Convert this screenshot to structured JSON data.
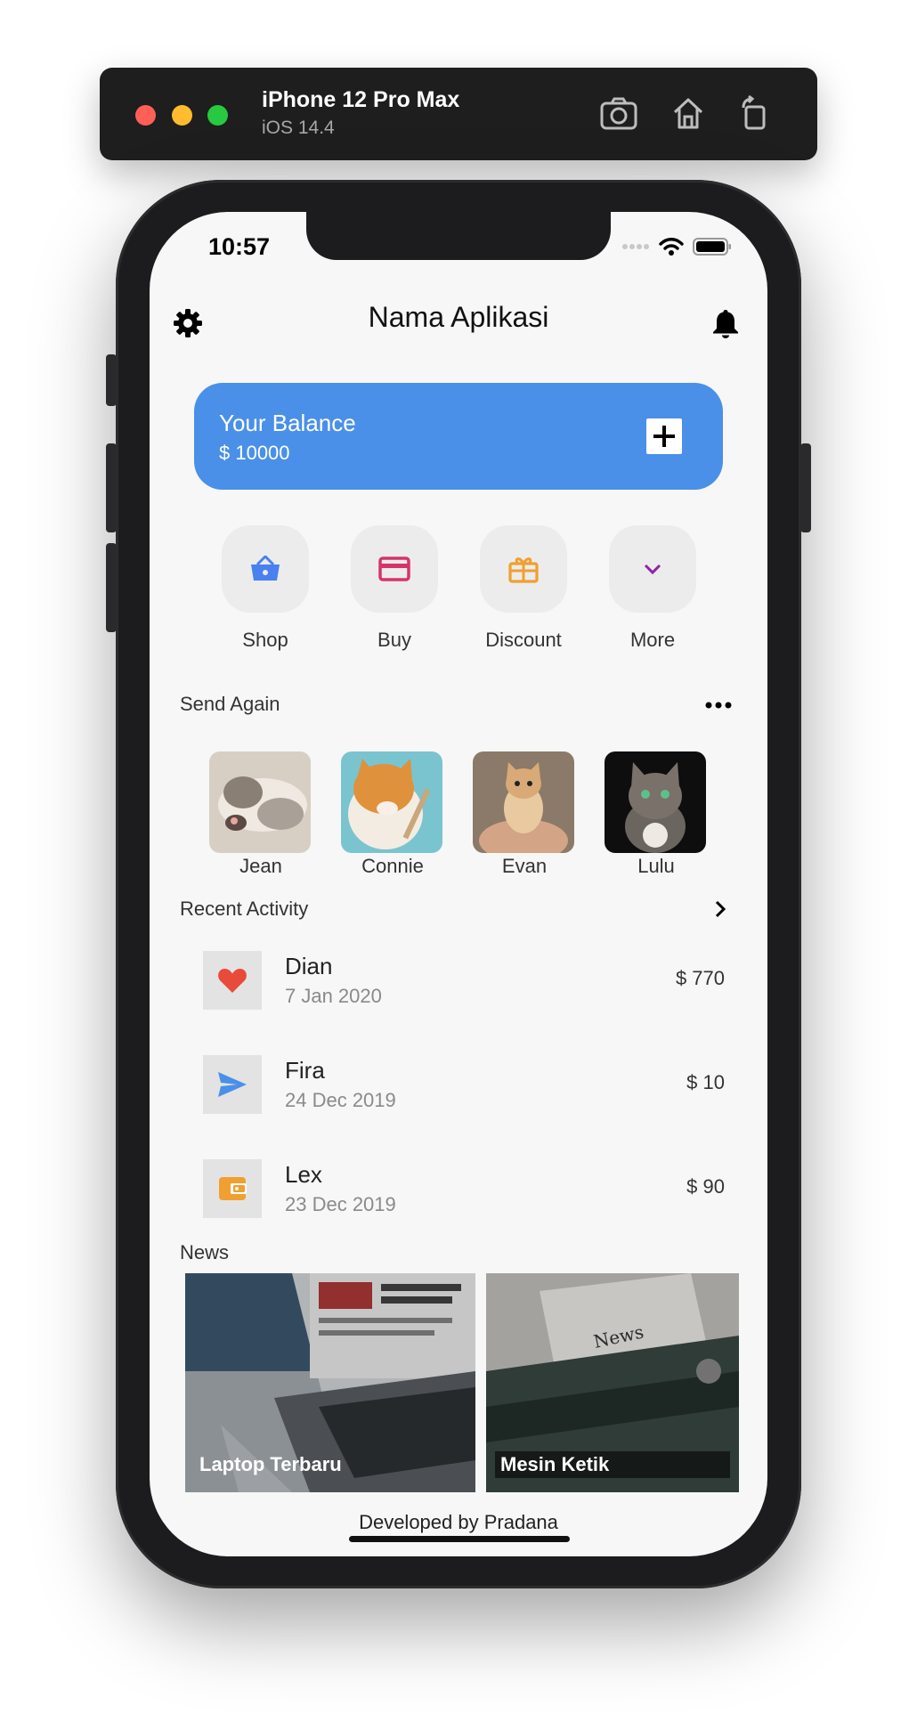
{
  "simulator": {
    "device_name": "iPhone 12 Pro Max",
    "os_version": "iOS 14.4",
    "buttons": [
      "screenshot-icon",
      "home-icon",
      "rotate-icon"
    ]
  },
  "status_bar": {
    "time": "10:57"
  },
  "app": {
    "title": "Nama Aplikasi",
    "settings_icon": "gear-icon",
    "notification_icon": "bell-icon"
  },
  "balance": {
    "label": "Your Balance",
    "amount": "$ 10000",
    "add_icon": "plus-icon",
    "color": "#4a90e8"
  },
  "actions": [
    {
      "label": "Shop",
      "icon": "basket-icon",
      "color": "#4a80f0"
    },
    {
      "label": "Buy",
      "icon": "credit-card-icon",
      "color": "#d6336c"
    },
    {
      "label": "Discount",
      "icon": "gift-icon",
      "color": "#f0a030"
    },
    {
      "label": "More",
      "icon": "chevron-down-icon",
      "color": "#8e24aa"
    }
  ],
  "send_again": {
    "title": "Send Again",
    "more_icon": "more-horizontal-icon",
    "contacts": [
      {
        "name": "Jean"
      },
      {
        "name": "Connie"
      },
      {
        "name": "Evan"
      },
      {
        "name": "Lulu"
      }
    ]
  },
  "recent_activity": {
    "title": "Recent Activity",
    "arrow_icon": "chevron-right-icon",
    "items": [
      {
        "name": "Dian",
        "date": "7 Jan 2020",
        "amount": "$ 770",
        "icon": "heart-icon",
        "color": "#e84a3c"
      },
      {
        "name": "Fira",
        "date": "24 Dec 2019",
        "amount": "$ 10",
        "icon": "send-icon",
        "color": "#4a90e8"
      },
      {
        "name": "Lex",
        "date": "23 Dec 2019",
        "amount": "$ 90",
        "icon": "wallet-icon",
        "color": "#f0a030"
      }
    ]
  },
  "news": {
    "title": "News",
    "items": [
      {
        "title": "Laptop Terbaru"
      },
      {
        "title": "Mesin Ketik"
      }
    ]
  },
  "footer": {
    "text": "Developed by Pradana"
  }
}
